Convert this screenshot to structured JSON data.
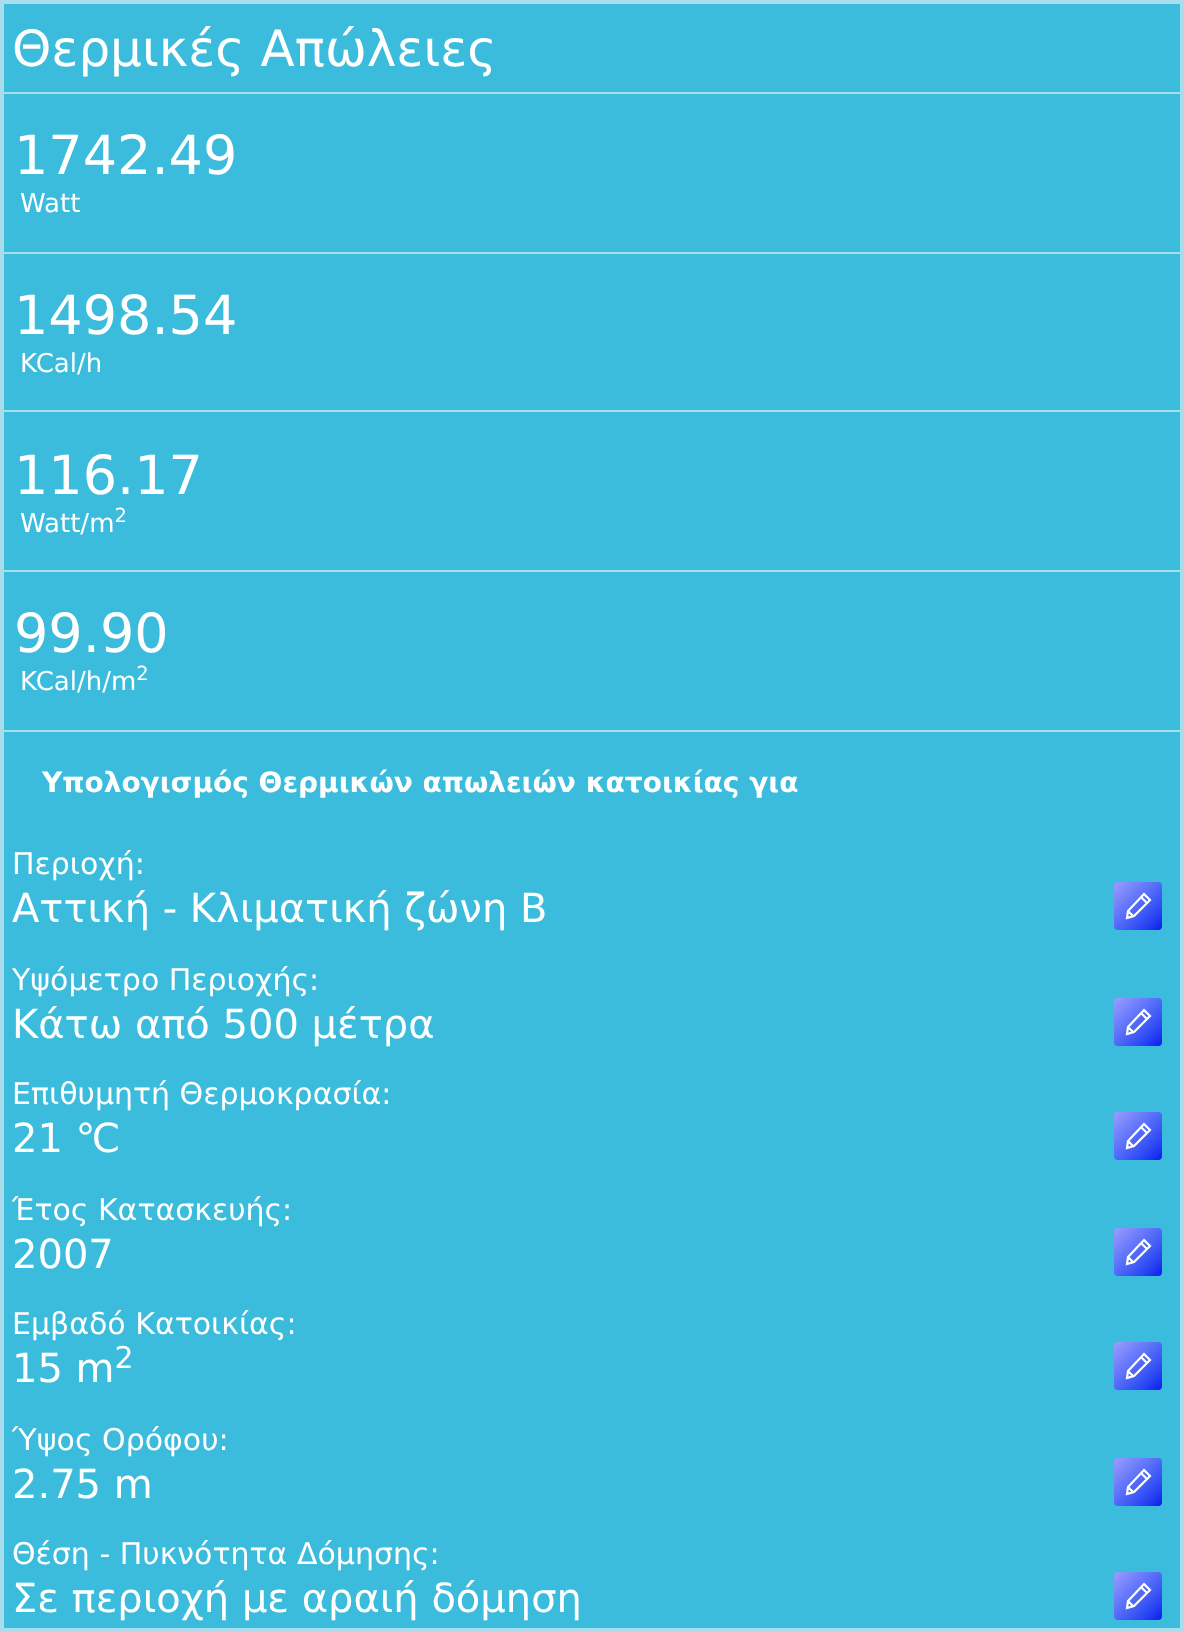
{
  "title": "Θερμικές Απώλειες",
  "results": [
    {
      "value": "1742.49",
      "unit": "Watt"
    },
    {
      "value": "1498.54",
      "unit": "KCal/h"
    },
    {
      "value": "116.17",
      "unit": "Watt/m$^{2}$"
    },
    {
      "value": "99.90",
      "unit": "KCal/h/m$^{2}$"
    }
  ],
  "section_heading": "Υπολογισμός Θερμικών απωλειών κατοικίας για",
  "parameters": [
    {
      "label": "Περιοχή:",
      "value": "Αττική - Κλιματική ζώνη Β"
    },
    {
      "label": "Υψόμετρο Περιοχής:",
      "value": "Κάτω από 500 μέτρα"
    },
    {
      "label": "Επιθυμητή Θερμοκρασία:",
      "value": "21 ℃"
    },
    {
      "label": "Έτος Κατασκευής:",
      "value": "2007"
    },
    {
      "label": "Εμβαδό Κατοικίας:",
      "value": "15 m$^{2}$"
    },
    {
      "label": "Ύψος Ορόφου:",
      "value": "2.75 m"
    },
    {
      "label": "Θέση - Πυκνότητα Δόμησης:",
      "value": "Σε περιοχή με αραιή δόμηση"
    }
  ]
}
